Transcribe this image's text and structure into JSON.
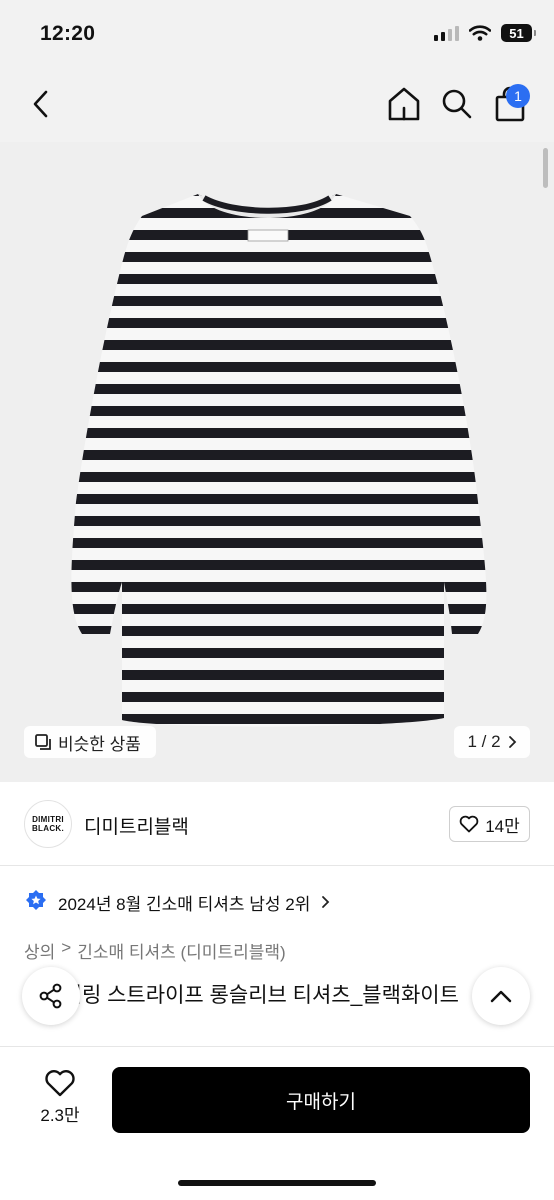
{
  "status": {
    "time": "12:20",
    "battery": "51"
  },
  "nav": {
    "cart_count": "1"
  },
  "image": {
    "similar_label": "비슷한 상품",
    "pager": "1 / 2"
  },
  "brand": {
    "logo_line1": "DIMITRI",
    "logo_line2": "BLACK.",
    "name": "디미트리블랙",
    "likes": "14만"
  },
  "rank": {
    "text": "2024년 8월 긴소매 티셔츠 남성 2위"
  },
  "breadcrumb": {
    "level1": "상의",
    "level2": "긴소매 티셔츠 (디미트리블랙)"
  },
  "product": {
    "title": "레이어링 스트라이프 롱슬리브 티셔츠_블랙화이트"
  },
  "bottom": {
    "wish_count": "2.3만",
    "buy_label": "구매하기"
  },
  "colors": {
    "accent": "#2b6ef2",
    "buy_bg": "#000000",
    "stripe": "#1c1c22"
  }
}
